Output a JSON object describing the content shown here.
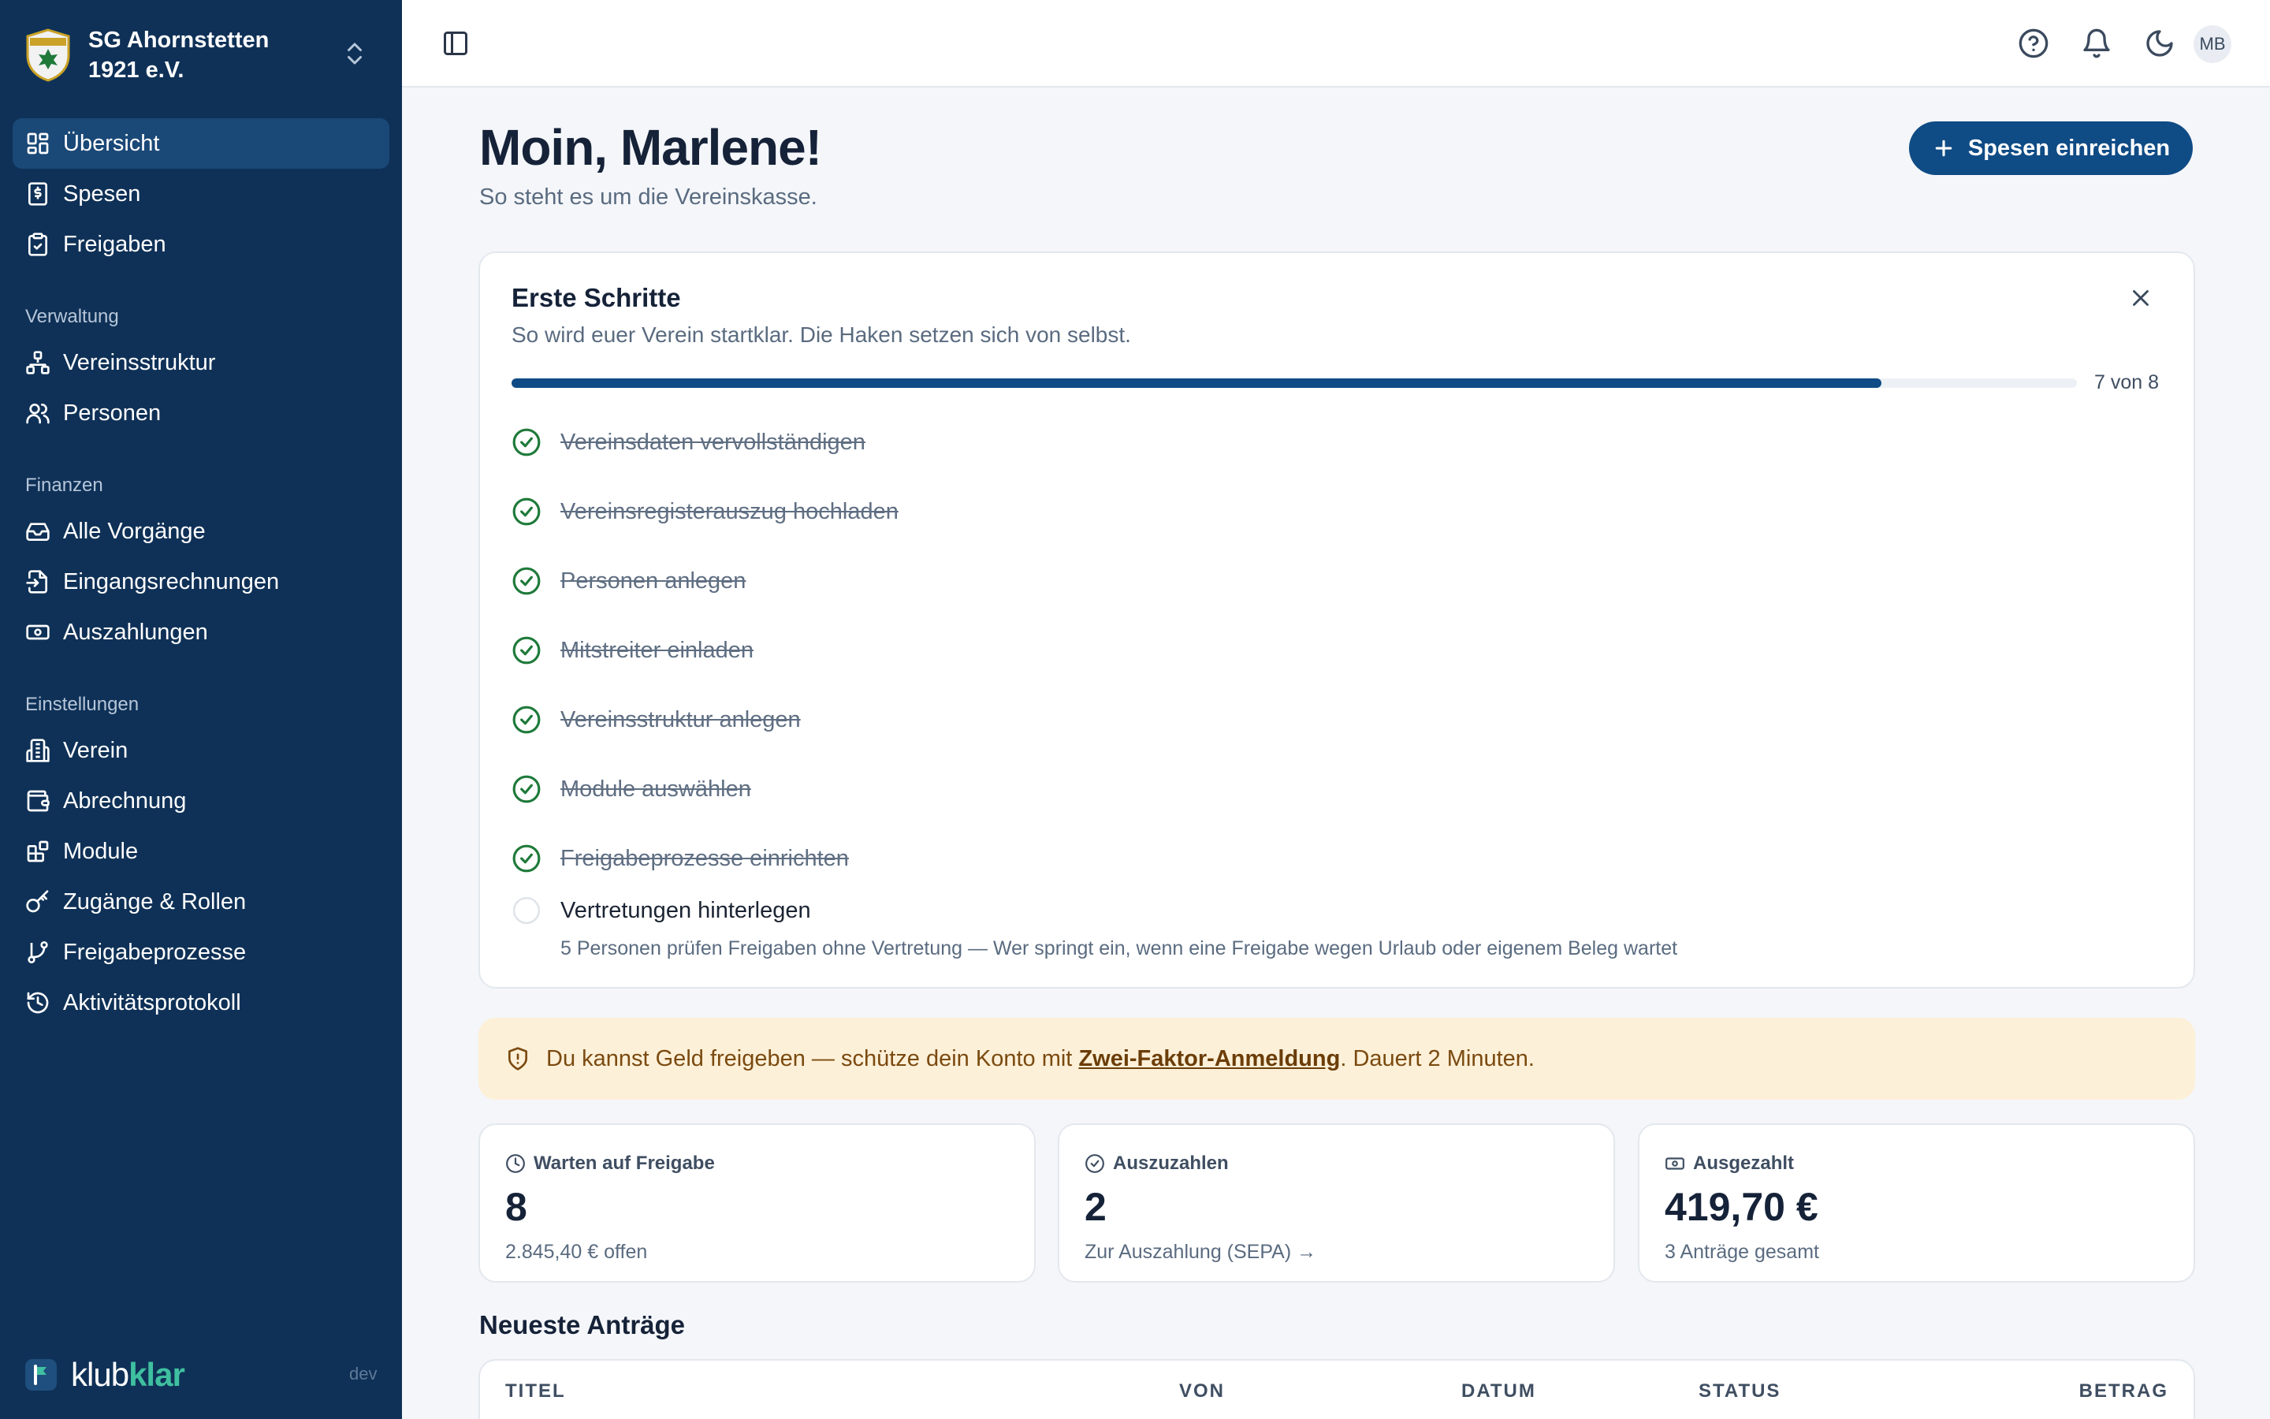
{
  "org": {
    "name": "SG Ahornstetten 1921 e.V."
  },
  "nav": {
    "main": [
      {
        "label": "Übersicht",
        "icon": "dashboard-icon",
        "active": true
      },
      {
        "label": "Spesen",
        "icon": "receipt-icon"
      },
      {
        "label": "Freigaben",
        "icon": "clipboard-check-icon"
      }
    ],
    "sections": [
      {
        "title": "Verwaltung",
        "items": [
          {
            "label": "Vereinsstruktur",
            "icon": "hierarchy-icon"
          },
          {
            "label": "Personen",
            "icon": "users-icon"
          }
        ]
      },
      {
        "title": "Finanzen",
        "items": [
          {
            "label": "Alle Vorgänge",
            "icon": "inbox-icon"
          },
          {
            "label": "Eingangsrechnungen",
            "icon": "file-import-icon"
          },
          {
            "label": "Auszahlungen",
            "icon": "banknote-icon"
          }
        ]
      },
      {
        "title": "Einstellungen",
        "items": [
          {
            "label": "Verein",
            "icon": "building-icon"
          },
          {
            "label": "Abrechnung",
            "icon": "wallet-icon"
          },
          {
            "label": "Module",
            "icon": "blocks-icon"
          },
          {
            "label": "Zugänge & Rollen",
            "icon": "key-icon"
          },
          {
            "label": "Freigabeprozesse",
            "icon": "git-branch-icon"
          },
          {
            "label": "Aktivitätsprotokoll",
            "icon": "history-icon"
          }
        ]
      }
    ]
  },
  "brand": {
    "part1": "klub",
    "part2": "klar",
    "env": "dev"
  },
  "user": {
    "initials": "MB"
  },
  "header": {
    "greeting": "Moin, Marlene!",
    "subtitle": "So steht es um die Vereinskasse.",
    "cta": "Spesen einreichen"
  },
  "onboarding": {
    "title": "Erste Schritte",
    "subtitle": "So wird euer Verein startklar. Die Haken setzen sich von selbst.",
    "progress_label": "7 von 8",
    "progress": 0.875,
    "steps": [
      {
        "label": "Vereinsdaten vervollständigen",
        "done": true
      },
      {
        "label": "Vereinsregisterauszug hochladen",
        "done": true
      },
      {
        "label": "Personen anlegen",
        "done": true
      },
      {
        "label": "Mitstreiter einladen",
        "done": true
      },
      {
        "label": "Vereinsstruktur anlegen",
        "done": true
      },
      {
        "label": "Module auswählen",
        "done": true
      },
      {
        "label": "Freigabeprozesse einrichten",
        "done": true
      },
      {
        "label": "Vertretungen hinterlegen",
        "done": false,
        "description": "5 Personen prüfen Freigaben ohne Vertretung — Wer springt ein, wenn eine Freigabe wegen Urlaub oder eigenem Beleg wartet"
      }
    ]
  },
  "banner": {
    "prefix": "Du kannst Geld freigeben — schütze dein Konto mit ",
    "link": "Zwei-Faktor-Anmeldung",
    "suffix": ". Dauert 2 Minuten."
  },
  "stats": [
    {
      "label": "Warten auf Freigabe",
      "icon": "clock-icon",
      "value": "8",
      "foot": "2.845,40 € offen"
    },
    {
      "label": "Auszuzahlen",
      "icon": "check-circle-icon",
      "value": "2",
      "foot": "Zur Auszahlung (SEPA) →"
    },
    {
      "label": "Ausgezahlt",
      "icon": "banknote-icon",
      "value": "419,70 €",
      "foot": "3 Anträge gesamt"
    }
  ],
  "recent": {
    "title": "Neueste Anträge",
    "columns": [
      "TITEL",
      "VON",
      "DATUM",
      "STATUS",
      "BETRAG"
    ]
  },
  "colors": {
    "sidebar": "#0f3157",
    "primary": "#0f4b85",
    "success": "#1f7a3a",
    "warning_bg": "#fdf0d8"
  }
}
